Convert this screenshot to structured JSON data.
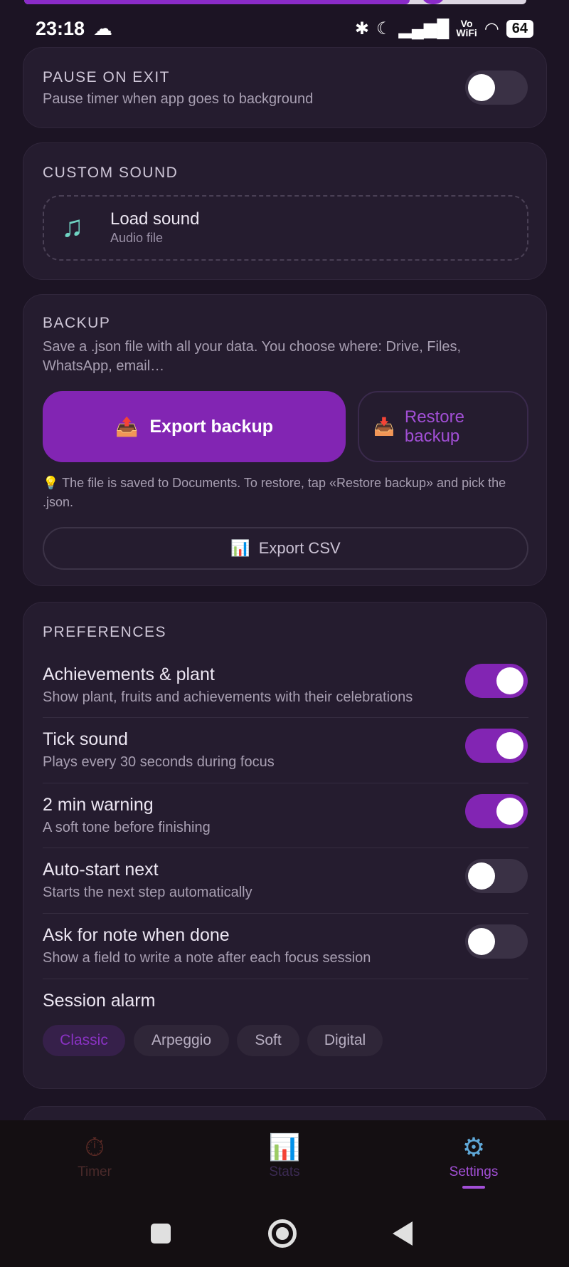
{
  "statusbar": {
    "time": "23:18",
    "vowifi_top": "Vo",
    "vowifi_bottom": "WiFi",
    "battery": "64"
  },
  "pause_on_exit": {
    "title": "PAUSE ON EXIT",
    "description": "Pause timer when app goes to background",
    "enabled": false
  },
  "custom_sound": {
    "title": "CUSTOM SOUND",
    "load_label": "Load sound",
    "load_sublabel": "Audio file"
  },
  "backup": {
    "title": "BACKUP",
    "description": "Save a .json file with all your data. You choose where: Drive, Files, WhatsApp, email…",
    "export_label": "Export backup",
    "restore_label_line1": "Restore",
    "restore_label_line2": "backup",
    "hint": "The file is saved to Documents. To restore, tap «Restore backup» and pick the .json.",
    "csv_label": "Export CSV"
  },
  "preferences": {
    "title": "PREFERENCES",
    "items": [
      {
        "label": "Achievements & plant",
        "description": "Show plant, fruits and achievements with their celebrations",
        "enabled": true
      },
      {
        "label": "Tick sound",
        "description": "Plays every 30 seconds during focus",
        "enabled": true
      },
      {
        "label": "2 min warning",
        "description": "A soft tone before finishing",
        "enabled": true
      },
      {
        "label": "Auto-start next",
        "description": "Starts the next step automatically",
        "enabled": false
      },
      {
        "label": "Ask for note when done",
        "description": "Show a field to write a note after each focus session",
        "enabled": false
      }
    ],
    "session_alarm_label": "Session alarm",
    "alarm_options": [
      "Classic",
      "Arpeggio",
      "Soft",
      "Digital"
    ],
    "alarm_selected": "Classic"
  },
  "bottom_nav": {
    "items": [
      {
        "label": "Timer",
        "icon": "tomato-timer-icon"
      },
      {
        "label": "Stats",
        "icon": "bar-chart-icon"
      },
      {
        "label": "Settings",
        "icon": "gear-icon"
      }
    ],
    "active": "Settings"
  },
  "colors": {
    "accent": "#8225b3",
    "background": "#1c1424",
    "card": "#251c2f"
  }
}
